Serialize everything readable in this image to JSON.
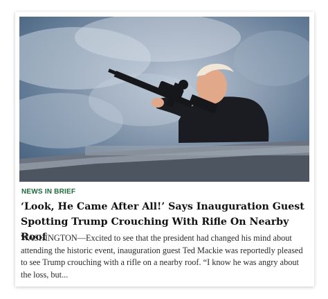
{
  "article": {
    "kicker": "NEWS IN BRIEF",
    "headline": "‘Look, He Came After All!’ Says Inauguration Guest Spotting Trump Crouching With Rifle On Nearby Roof",
    "excerpt": "WASHINGTON—Excited to see that the president had changed his mind about attending the historic event, inauguration guest Ted Mackie was reportedly pleased to see Trump crouching with a rifle on a nearby roof. “I know he was angry about the loss, but..."
  },
  "colors": {
    "kicker": "#1f6b3d",
    "headline": "#111111",
    "sky": "#5f7893"
  }
}
